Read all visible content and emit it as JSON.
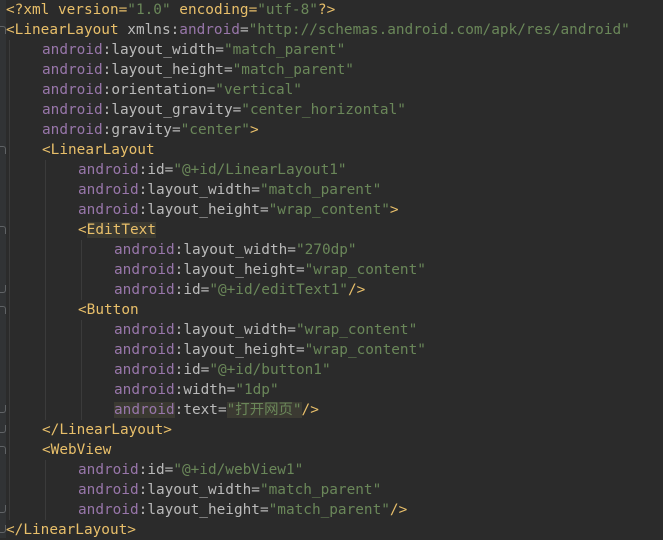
{
  "editor": {
    "language": "xml",
    "colors": {
      "background": "#2b2b2b",
      "tag": "#e8bf6a",
      "namespace": "#9876aa",
      "string": "#6a8759",
      "text": "#a9b7c6"
    },
    "lines": [
      {
        "indent": 0,
        "tokens": [
          {
            "t": "decl",
            "v": "<?xml version="
          },
          {
            "t": "str",
            "v": "\"1.0\""
          },
          {
            "t": "decl",
            "v": " encoding="
          },
          {
            "t": "str",
            "v": "\"utf-8\""
          },
          {
            "t": "decl",
            "v": "?>"
          }
        ]
      },
      {
        "indent": 0,
        "tokens": [
          {
            "t": "tag",
            "v": "<LinearLayout "
          },
          {
            "t": "attr",
            "v": "xmlns:"
          },
          {
            "t": "ns",
            "v": "android"
          },
          {
            "t": "attr",
            "v": "="
          },
          {
            "t": "str",
            "v": "\"http://schemas.android.com/apk/res/android\""
          }
        ]
      },
      {
        "indent": 1,
        "tokens": [
          {
            "t": "ns",
            "v": "android"
          },
          {
            "t": "attr",
            "v": ":layout_width="
          },
          {
            "t": "str",
            "v": "\"match_parent\""
          }
        ]
      },
      {
        "indent": 1,
        "tokens": [
          {
            "t": "ns",
            "v": "android"
          },
          {
            "t": "attr",
            "v": ":layout_height="
          },
          {
            "t": "str",
            "v": "\"match_parent\""
          }
        ]
      },
      {
        "indent": 1,
        "tokens": [
          {
            "t": "ns",
            "v": "android"
          },
          {
            "t": "attr",
            "v": ":orientation="
          },
          {
            "t": "str",
            "v": "\"vertical\""
          }
        ]
      },
      {
        "indent": 1,
        "tokens": [
          {
            "t": "ns",
            "v": "android"
          },
          {
            "t": "attr",
            "v": ":layout_gravity="
          },
          {
            "t": "str",
            "v": "\"center_horizontal\""
          }
        ]
      },
      {
        "indent": 1,
        "tokens": [
          {
            "t": "ns",
            "v": "android"
          },
          {
            "t": "attr",
            "v": ":gravity="
          },
          {
            "t": "str",
            "v": "\"center\""
          },
          {
            "t": "tag",
            "v": ">"
          }
        ]
      },
      {
        "indent": 1,
        "tokens": [
          {
            "t": "tag",
            "v": "<LinearLayout"
          }
        ]
      },
      {
        "indent": 2,
        "tokens": [
          {
            "t": "ns",
            "v": "android"
          },
          {
            "t": "attr",
            "v": ":id="
          },
          {
            "t": "str",
            "v": "\"@+id/LinearLayout1\""
          }
        ]
      },
      {
        "indent": 2,
        "tokens": [
          {
            "t": "ns",
            "v": "android"
          },
          {
            "t": "attr",
            "v": ":layout_width="
          },
          {
            "t": "str",
            "v": "\"match_parent\""
          }
        ]
      },
      {
        "indent": 2,
        "tokens": [
          {
            "t": "ns",
            "v": "android"
          },
          {
            "t": "attr",
            "v": ":layout_height="
          },
          {
            "t": "str",
            "v": "\"wrap_content\""
          },
          {
            "t": "tag",
            "v": ">"
          }
        ]
      },
      {
        "indent": 2,
        "tokens": [
          {
            "t": "tag",
            "v": "<",
            "hl": false
          },
          {
            "t": "tag",
            "v": "EditText",
            "hl": true
          }
        ]
      },
      {
        "indent": 3,
        "tokens": [
          {
            "t": "ns",
            "v": "android"
          },
          {
            "t": "attr",
            "v": ":layout_width="
          },
          {
            "t": "str",
            "v": "\"270dp\""
          }
        ]
      },
      {
        "indent": 3,
        "tokens": [
          {
            "t": "ns",
            "v": "android"
          },
          {
            "t": "attr",
            "v": ":layout_height="
          },
          {
            "t": "str",
            "v": "\"wrap_content\""
          }
        ]
      },
      {
        "indent": 3,
        "tokens": [
          {
            "t": "ns",
            "v": "android"
          },
          {
            "t": "attr",
            "v": ":id="
          },
          {
            "t": "str",
            "v": "\"@+id/editText1\""
          },
          {
            "t": "tag",
            "v": "/>"
          }
        ]
      },
      {
        "indent": 2,
        "tokens": [
          {
            "t": "tag",
            "v": "<Button"
          }
        ]
      },
      {
        "indent": 3,
        "tokens": [
          {
            "t": "ns",
            "v": "android"
          },
          {
            "t": "attr",
            "v": ":layout_width="
          },
          {
            "t": "str",
            "v": "\"wrap_content\""
          }
        ]
      },
      {
        "indent": 3,
        "tokens": [
          {
            "t": "ns",
            "v": "android"
          },
          {
            "t": "attr",
            "v": ":layout_height="
          },
          {
            "t": "str",
            "v": "\"wrap_content\""
          }
        ]
      },
      {
        "indent": 3,
        "tokens": [
          {
            "t": "ns",
            "v": "android"
          },
          {
            "t": "attr",
            "v": ":id="
          },
          {
            "t": "str",
            "v": "\"@+id/button1\""
          }
        ]
      },
      {
        "indent": 3,
        "tokens": [
          {
            "t": "ns",
            "v": "android"
          },
          {
            "t": "attr",
            "v": ":width="
          },
          {
            "t": "str",
            "v": "\"1dp\""
          }
        ]
      },
      {
        "indent": 3,
        "tokens": [
          {
            "t": "ns",
            "v": "android",
            "hl": true
          },
          {
            "t": "attr",
            "v": ":text="
          },
          {
            "t": "str",
            "v": "\"打开网页\"",
            "hl": true
          },
          {
            "t": "tag",
            "v": "/>"
          }
        ]
      },
      {
        "indent": 1,
        "tokens": [
          {
            "t": "tag",
            "v": "</LinearLayout>"
          }
        ]
      },
      {
        "indent": 1,
        "tokens": [
          {
            "t": "tag",
            "v": "<WebView"
          }
        ]
      },
      {
        "indent": 2,
        "tokens": [
          {
            "t": "ns",
            "v": "android"
          },
          {
            "t": "attr",
            "v": ":id="
          },
          {
            "t": "str",
            "v": "\"@+id/webView1\""
          }
        ]
      },
      {
        "indent": 2,
        "tokens": [
          {
            "t": "ns",
            "v": "android"
          },
          {
            "t": "attr",
            "v": ":layout_width="
          },
          {
            "t": "str",
            "v": "\"match_parent\""
          }
        ]
      },
      {
        "indent": 2,
        "tokens": [
          {
            "t": "ns",
            "v": "android"
          },
          {
            "t": "attr",
            "v": ":layout_height="
          },
          {
            "t": "str",
            "v": "\"match_parent\""
          },
          {
            "t": "tag",
            "v": "/>"
          }
        ]
      },
      {
        "indent": 0,
        "tokens": [
          {
            "t": "tag",
            "v": "</LinearLayout>"
          }
        ]
      }
    ]
  }
}
